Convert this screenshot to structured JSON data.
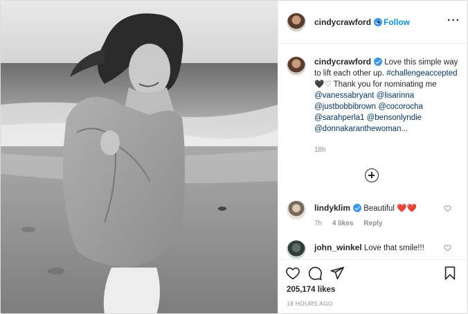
{
  "post": {
    "author": "cindycrawford",
    "follow_label": "Follow",
    "separator": "•",
    "more_label": "···",
    "caption": {
      "username": "cindycrawford",
      "text_1": "Love this simple way to lift each other up.",
      "hashtag": "#challengeaccepted",
      "hearts": "🖤♡",
      "text_2": "Thank you for nominating me",
      "mentions": "@vanessabryant @lisarinna @justbobbibrown @cocorocha @sarahperla1 @bensonlyndie @donnakaranthewoman..."
    },
    "time": "18h",
    "likes": "205,174 likes",
    "ago": "18 HOURS AGO"
  },
  "comments": [
    {
      "username": "lindyklim",
      "text": "Beautiful",
      "emoji": "❤️❤️",
      "time": "7h",
      "likes": "4 likes",
      "reply": "Reply"
    },
    {
      "username": "john_winkel",
      "text": "Love that smile!!!"
    }
  ],
  "icons": {
    "like": "heart-icon",
    "comment": "comment-icon",
    "share": "share-icon",
    "save": "bookmark-icon",
    "more": "more-icon",
    "load_more": "plus-circle-icon",
    "verified": "verified-badge-icon"
  },
  "colors": {
    "link": "#0095f6",
    "verified": "#3897f0",
    "mention": "#00376b",
    "muted": "#8e8e8e",
    "emoji_red": "#e0245e"
  }
}
